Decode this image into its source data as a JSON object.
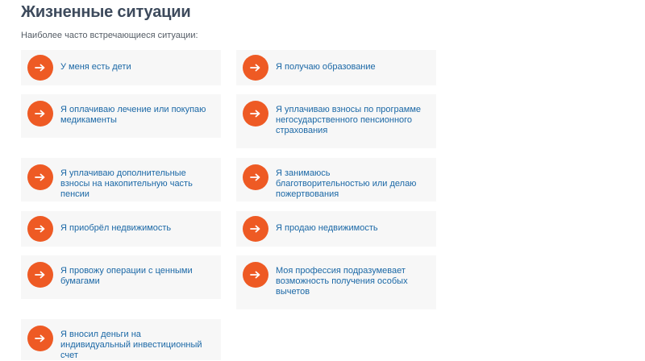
{
  "page": {
    "title": "Жизненные ситуации",
    "subtitle": "Наиболее часто встречающиеся ситуации:"
  },
  "situations": [
    {
      "label": "У меня есть дети"
    },
    {
      "label": "Я получаю образование"
    },
    {
      "label": "Я оплачиваю лечение или покупаю медикаменты"
    },
    {
      "label": "Я уплачиваю взносы по программе негосударственного пенсионного страхования"
    },
    {
      "label": "Я уплачиваю дополнительные взносы на накопительную часть пенсии"
    },
    {
      "label": "Я занимаюсь благотворительностью или делаю пожертвования"
    },
    {
      "label": "Я приобрёл недвижимость"
    },
    {
      "label": "Я продаю недвижимость"
    },
    {
      "label": "Я провожу операции с ценными бумагами"
    },
    {
      "label": "Моя профессия подразумевает возможность получения особых вычетов"
    },
    {
      "label": "Я вносил деньги на индивидуальный инвестиционный счет"
    }
  ],
  "colors": {
    "accent": "#ee5a24",
    "link": "#1b68a6",
    "title": "#3d4a5c",
    "card_bg": "#f7f7f7"
  },
  "icons": {
    "card_icon": "arrow-right-icon"
  }
}
